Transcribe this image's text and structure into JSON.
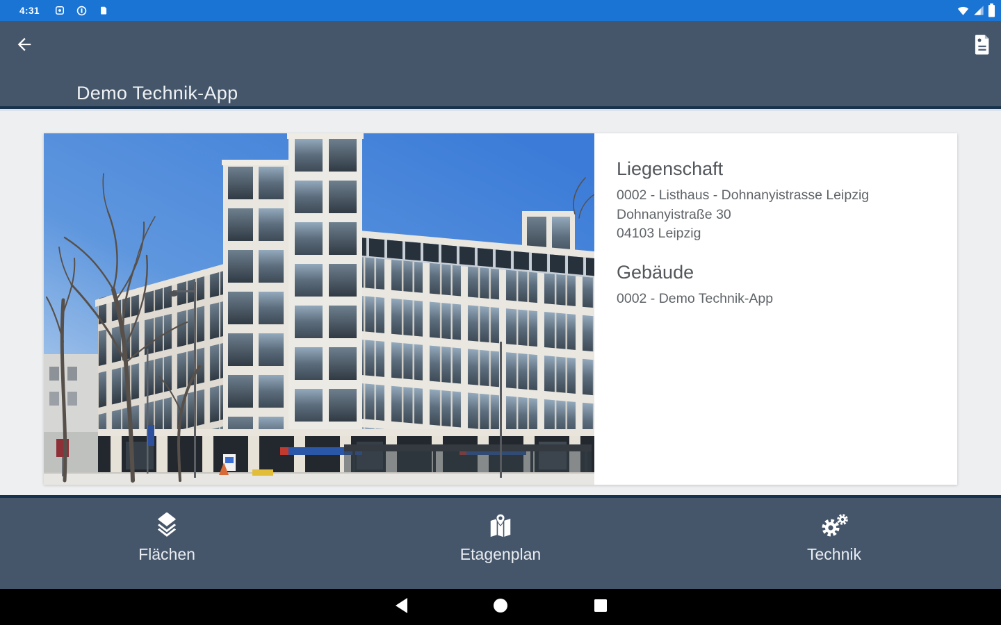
{
  "status_bar": {
    "time": "4:31",
    "icons_left": [
      "notification-app-icon",
      "notification-circle-icon",
      "notification-card-icon"
    ],
    "icons_right": [
      "wifi-icon",
      "cellular-signal-icon",
      "battery-icon"
    ]
  },
  "app_bar": {
    "title": "Demo Technik-App",
    "back_icon": "arrow-left-icon",
    "action_icon": "document-icon"
  },
  "card": {
    "photo_alt": "office-building-photo",
    "sections": [
      {
        "heading": "Liegenschaft",
        "lines": [
          "0002 - Listhaus - Dohnanyistrasse Leipzig",
          "Dohnanyistraße 30",
          "04103 Leipzig"
        ]
      },
      {
        "heading": "Gebäude",
        "lines": [
          "0002 - Demo Technik-App"
        ]
      }
    ]
  },
  "bottom_nav": {
    "items": [
      {
        "label": "Flächen",
        "icon": "layers-icon"
      },
      {
        "label": "Etagenplan",
        "icon": "map-pin-icon"
      },
      {
        "label": "Technik",
        "icon": "gears-icon"
      }
    ]
  },
  "android_nav": {
    "buttons": [
      "back",
      "home",
      "recents"
    ]
  },
  "colors": {
    "status_bar_blue": "#1a74d4",
    "bar_slate": "#46566a",
    "divider_navy": "#16324c",
    "content_bg": "#edeff1",
    "card_bg": "#ffffff",
    "heading_text": "#53575b",
    "body_text": "#5f6468",
    "nav_label": "#e9edf2"
  }
}
